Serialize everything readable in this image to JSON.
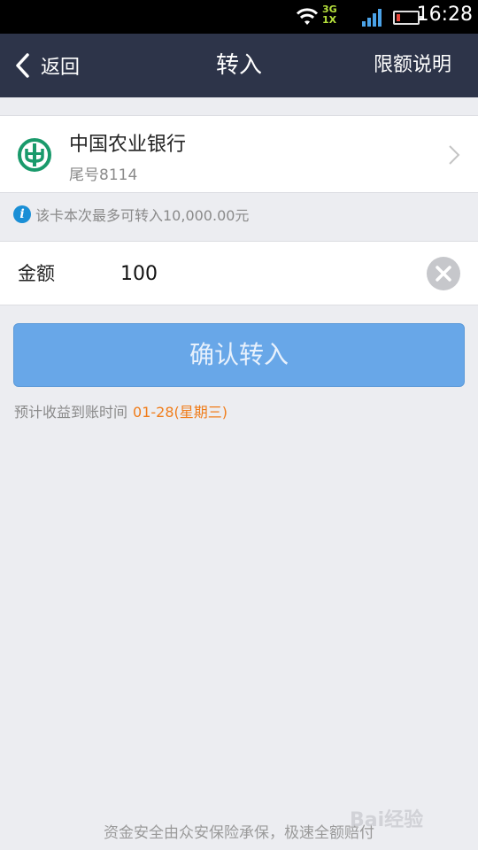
{
  "status_bar": {
    "network_3g": "3G",
    "network_1x": "1X",
    "time": "16:28"
  },
  "nav": {
    "back_label": "返回",
    "title": "转入",
    "right_label": "限额说明"
  },
  "bank": {
    "name": "中国农业银行",
    "tail": "尾号8114",
    "logo_color": "#199a6b"
  },
  "limit_tip": {
    "icon": "i",
    "text": "该卡本次最多可转入10,000.00元"
  },
  "amount": {
    "label": "金额",
    "value": "100"
  },
  "confirm_button": {
    "label": "确认转入"
  },
  "arrival": {
    "prefix": "预计收益到账时间",
    "date": "01-28(星期三)"
  },
  "footer": {
    "note": "资金安全由众安保险承保，极速全额赔付"
  },
  "watermark": {
    "text": "Bai经验"
  },
  "colors": {
    "navbar": "#2d3449",
    "accent_button": "#68a7e8",
    "date_highlight": "#f07d1b",
    "info_icon": "#1a8fd6"
  }
}
